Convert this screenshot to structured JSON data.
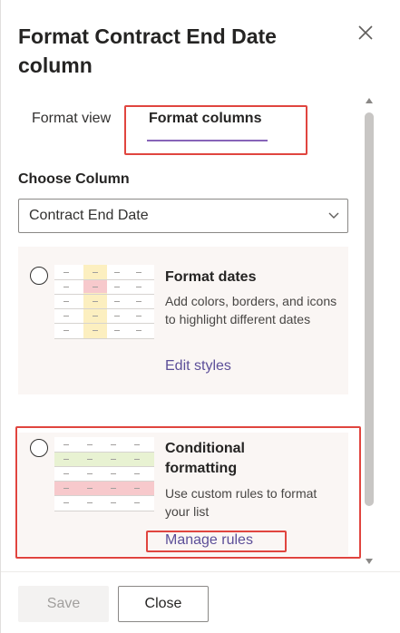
{
  "panel": {
    "title": "Format Contract End Date column",
    "close_icon": "close-icon"
  },
  "tabs": [
    {
      "label": "Format view",
      "selected": false
    },
    {
      "label": "Format columns",
      "selected": true
    }
  ],
  "choose_column": {
    "label": "Choose Column",
    "selected_value": "Contract End Date"
  },
  "options": [
    {
      "title": "Format dates",
      "description": "Add colors, borders, and icons to highlight different dates",
      "link": "Edit styles",
      "selected": false
    },
    {
      "title": "Conditional formatting",
      "description": "Use custom rules to format your list",
      "link": "Manage rules",
      "selected": false
    }
  ],
  "footer": {
    "save_label": "Save",
    "close_label": "Close"
  },
  "colors": {
    "accent": "#8764b8",
    "link": "#5c4f99",
    "highlight_annotation": "#e0453f",
    "card_background": "#faf6f4",
    "thumb_green": "#e8f2d2",
    "thumb_pink": "#f7c9cc",
    "thumb_yellow": "#fcefc0"
  }
}
